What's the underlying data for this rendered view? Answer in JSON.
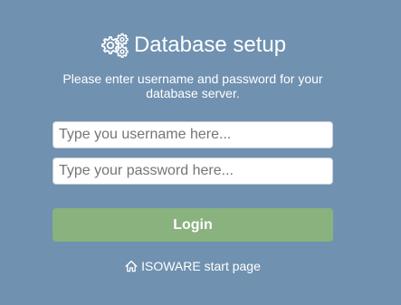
{
  "header": {
    "icon": "gears-icon",
    "title": "Database setup",
    "subtitle_line1": "Please enter username and password for your",
    "subtitle_line2": "database server."
  },
  "form": {
    "username_placeholder": "Type you username here...",
    "username_value": "",
    "password_placeholder": "Type your password here...",
    "password_value": "",
    "login_label": "Login"
  },
  "footer": {
    "icon": "home-icon",
    "start_link_label": "ISOWARE start page"
  },
  "colors": {
    "background": "#7091b0",
    "login_button": "#89b27f",
    "text": "#ffffff"
  }
}
